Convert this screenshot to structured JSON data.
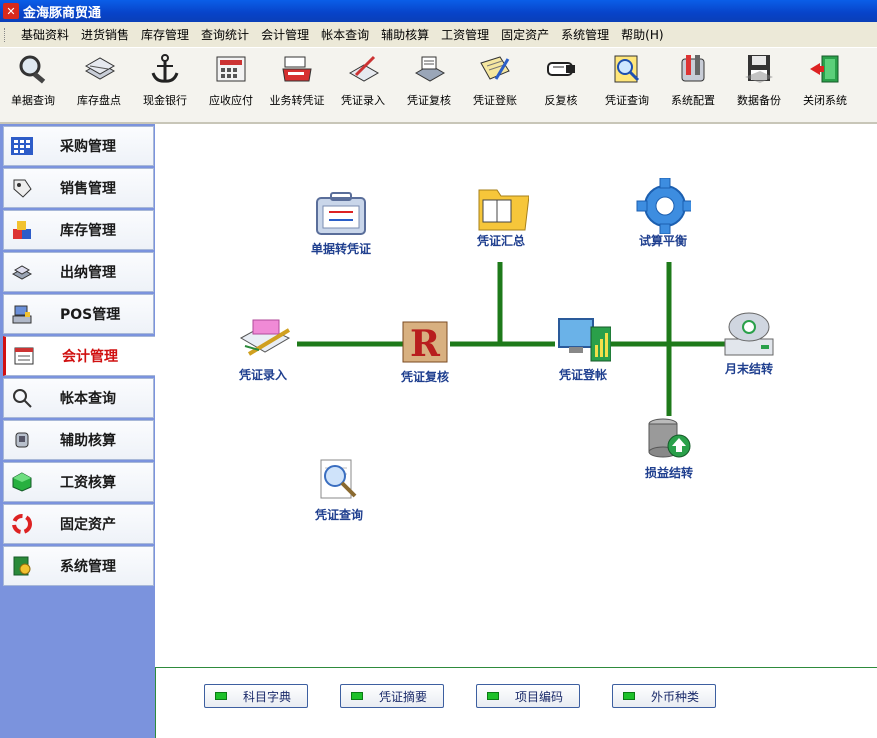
{
  "window": {
    "title": "金海豚商贸通"
  },
  "menu": [
    "基础资料",
    "进货销售",
    "库存管理",
    "查询统计",
    "会计管理",
    "帐本查询",
    "辅助核算",
    "工资管理",
    "固定资产",
    "系统管理",
    "帮助(H)"
  ],
  "toolbar": [
    {
      "label": "单据查询",
      "icon": "magnifier-icon"
    },
    {
      "label": "库存盘点",
      "icon": "stack-icon"
    },
    {
      "label": "现金银行",
      "icon": "anchor-icon"
    },
    {
      "label": "应收应付",
      "icon": "calculator-icon"
    },
    {
      "label": "业务转凭证",
      "icon": "cash-register-icon"
    },
    {
      "label": "凭证录入",
      "icon": "pen-paper-icon"
    },
    {
      "label": "凭证复核",
      "icon": "scanner-icon"
    },
    {
      "label": "凭证登账",
      "icon": "ledger-pen-icon"
    },
    {
      "label": "反复核",
      "icon": "hand-point-icon"
    },
    {
      "label": "凭证查询",
      "icon": "search-doc-icon"
    },
    {
      "label": "系统配置",
      "icon": "tools-icon"
    },
    {
      "label": "数据备份",
      "icon": "floppy-icon"
    },
    {
      "label": "关闭系统",
      "icon": "exit-door-icon"
    }
  ],
  "sidebar": [
    {
      "label": "采购管理",
      "icon": "grid-icon"
    },
    {
      "label": "销售管理",
      "icon": "tag-icon"
    },
    {
      "label": "库存管理",
      "icon": "boxes-icon"
    },
    {
      "label": "出纳管理",
      "icon": "coins-icon"
    },
    {
      "label": "POS管理",
      "icon": "pos-terminal-icon"
    },
    {
      "label": "会计管理",
      "icon": "ledger-icon"
    },
    {
      "label": "帐本查询",
      "icon": "magnifier-icon"
    },
    {
      "label": "辅助核算",
      "icon": "hand-icon"
    },
    {
      "label": "工资核算",
      "icon": "cube-icon"
    },
    {
      "label": "固定资产",
      "icon": "recycle-icon"
    },
    {
      "label": "系统管理",
      "icon": "gear-book-icon"
    }
  ],
  "active_sidebar": "会计管理",
  "flow": {
    "nodes": [
      {
        "id": "bill-to-voucher",
        "label": "单据转凭证",
        "icon": "toolbox-icon"
      },
      {
        "id": "voucher-summary",
        "label": "凭证汇总",
        "icon": "folder-book-icon"
      },
      {
        "id": "trial-balance",
        "label": "试算平衡",
        "icon": "gear-icon"
      },
      {
        "id": "voucher-entry",
        "label": "凭证录入",
        "icon": "envelope-pen-icon"
      },
      {
        "id": "voucher-review",
        "label": "凭证复核",
        "icon": "r-letter-icon"
      },
      {
        "id": "voucher-post",
        "label": "凭证登帐",
        "icon": "monitor-chart-icon"
      },
      {
        "id": "month-end",
        "label": "月末结转",
        "icon": "cd-drive-icon"
      },
      {
        "id": "pl-transfer",
        "label": "损益结转",
        "icon": "database-up-icon"
      },
      {
        "id": "voucher-query",
        "label": "凭证查询",
        "icon": "search-doc-icon"
      }
    ]
  },
  "bottom_buttons": [
    "科目字典",
    "凭证摘要",
    "项目编码",
    "外币种类"
  ],
  "colors": {
    "flow_line": "#1e7a1a",
    "label_blue": "#1f3f8f",
    "sidebar_bg": "#7b93dd",
    "active_red": "#d01010"
  }
}
